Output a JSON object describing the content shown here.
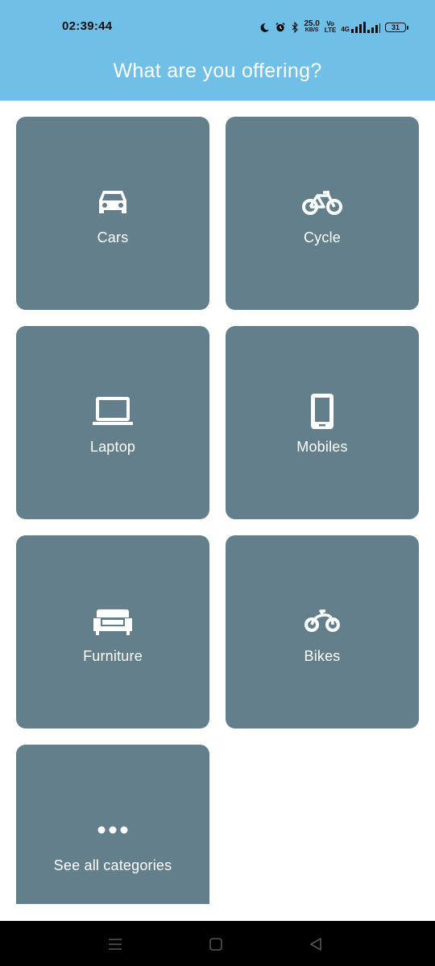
{
  "status_bar": {
    "time": "02:39:44",
    "net_speed_value": "25.0",
    "net_speed_unit": "KB/S",
    "volte_top": "Vo",
    "volte_bottom": "LTE",
    "signal_label_top": "4G",
    "battery_level": "31",
    "icons": [
      "moon-icon",
      "alarm-icon",
      "bluetooth-icon",
      "signal-icon",
      "battery-icon"
    ]
  },
  "header": {
    "title": "What are you offering?",
    "background": "#6fbfe7"
  },
  "categories": [
    {
      "label": "Cars",
      "icon": "car-icon"
    },
    {
      "label": "Cycle",
      "icon": "bicycle-icon"
    },
    {
      "label": "Laptop",
      "icon": "laptop-icon"
    },
    {
      "label": "Mobiles",
      "icon": "mobile-phone-icon"
    },
    {
      "label": "Furniture",
      "icon": "sofa-icon"
    },
    {
      "label": "Bikes",
      "icon": "motorbike-icon"
    },
    {
      "label": "See all categories",
      "icon": "more-dots-icon"
    }
  ],
  "tile_color": "#637f8b",
  "nav_bar": {
    "buttons": [
      "menu-icon",
      "home-icon",
      "back-icon"
    ]
  }
}
